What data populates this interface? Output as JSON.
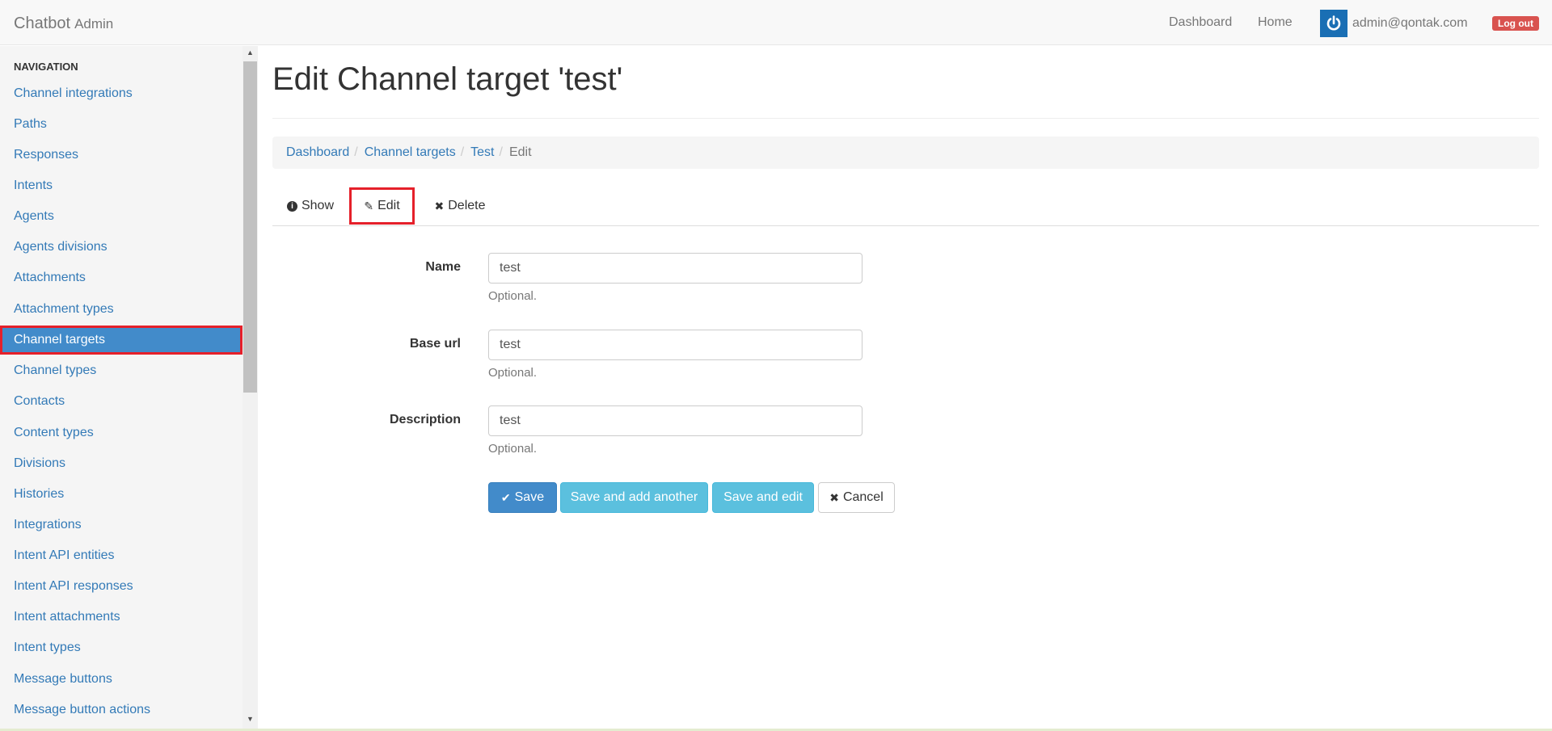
{
  "navbar": {
    "brand": "Chatbot",
    "brand_sub": "Admin",
    "links": [
      "Dashboard",
      "Home"
    ],
    "user_email": "admin@qontak.com",
    "logout_label": "Log out"
  },
  "sidebar": {
    "heading": "NAVIGATION",
    "items": [
      {
        "label": "Channel integrations"
      },
      {
        "label": "Paths"
      },
      {
        "label": "Responses"
      },
      {
        "label": "Intents"
      },
      {
        "label": "Agents"
      },
      {
        "label": "Agents divisions"
      },
      {
        "label": "Attachments"
      },
      {
        "label": "Attachment types"
      },
      {
        "label": "Channel targets",
        "active": true
      },
      {
        "label": "Channel types"
      },
      {
        "label": "Contacts"
      },
      {
        "label": "Content types"
      },
      {
        "label": "Divisions"
      },
      {
        "label": "Histories"
      },
      {
        "label": "Integrations"
      },
      {
        "label": "Intent API entities"
      },
      {
        "label": "Intent API responses"
      },
      {
        "label": "Intent attachments"
      },
      {
        "label": "Intent types"
      },
      {
        "label": "Message buttons"
      },
      {
        "label": "Message button actions"
      }
    ]
  },
  "main": {
    "title": "Edit Channel target 'test'",
    "breadcrumb": {
      "items": [
        "Dashboard",
        "Channel targets",
        "Test"
      ],
      "active": "Edit"
    },
    "tabs": [
      {
        "label": "Show",
        "icon": "info-circle-icon"
      },
      {
        "label": "Edit",
        "icon": "pencil-icon",
        "active": true
      },
      {
        "label": "Delete",
        "icon": "times-icon"
      }
    ],
    "form": {
      "fields": [
        {
          "label": "Name",
          "value": "test",
          "help": "Optional."
        },
        {
          "label": "Base url",
          "value": "test",
          "help": "Optional."
        },
        {
          "label": "Description",
          "value": "test",
          "help": "Optional."
        }
      ],
      "buttons": {
        "save": "Save",
        "save_add": "Save and add another",
        "save_edit": "Save and edit",
        "cancel": "Cancel"
      }
    }
  },
  "colors": {
    "link": "#337ab7",
    "active_nav": "#428bca",
    "highlight_border": "#e5202a",
    "logout": "#d9534f",
    "btn_info": "#5bc0de"
  }
}
